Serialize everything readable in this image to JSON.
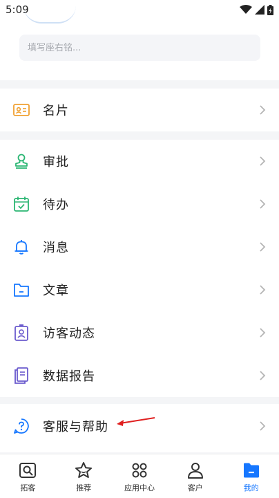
{
  "status_bar": {
    "time": "5:09"
  },
  "profile": {
    "signature_placeholder": "填写座右铭..."
  },
  "menu_groups": [
    {
      "items": [
        {
          "label": "名片",
          "icon": "business-card-icon"
        }
      ]
    },
    {
      "items": [
        {
          "label": "审批",
          "icon": "stamp-icon"
        },
        {
          "label": "待办",
          "icon": "calendar-check-icon"
        },
        {
          "label": "消息",
          "icon": "bell-icon"
        },
        {
          "label": "文章",
          "icon": "folder-icon"
        },
        {
          "label": "访客动态",
          "icon": "visitor-badge-icon"
        },
        {
          "label": "数据报告",
          "icon": "report-icon"
        }
      ]
    },
    {
      "items": [
        {
          "label": "客服与帮助",
          "icon": "help-circle-icon"
        }
      ]
    }
  ],
  "tabbar": {
    "tabs": [
      {
        "label": "拓客",
        "icon": "search-prospect-icon"
      },
      {
        "label": "推荐",
        "icon": "star-icon"
      },
      {
        "label": "应用中心",
        "icon": "app-grid-icon"
      },
      {
        "label": "客户",
        "icon": "person-icon"
      },
      {
        "label": "我的",
        "icon": "my-folder-icon",
        "active": true
      }
    ]
  },
  "colors": {
    "accent": "#1677ff",
    "green": "#2bb673",
    "orange": "#f0a030",
    "purple": "#6a5acd"
  }
}
